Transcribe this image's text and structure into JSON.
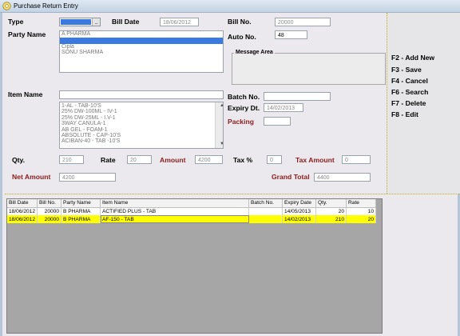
{
  "window": {
    "title": "Purchase Return Entry",
    "accent": "#3a7ae0"
  },
  "form": {
    "type": {
      "label": "Type",
      "value": ""
    },
    "bill_date": {
      "label": "Bill Date",
      "value": "18/06/2012"
    },
    "bill_no": {
      "label": "Bill No.",
      "value": "20000"
    },
    "party_name": {
      "label": "Party Name",
      "input_value": "A PHARMA",
      "list": [
        "",
        "Cipla",
        "SONU SHARMA"
      ]
    },
    "auto_no": {
      "label": "Auto No.",
      "value": "48"
    },
    "message_area": {
      "label": "Message Area"
    },
    "item_name": {
      "label": "Item Name",
      "input_value": "",
      "list": [
        "1-AL - TAB-10'S",
        "25% DW-100ML - IV-1",
        "25% DW-25ML - I.V-1",
        "3WAY CANULA-1",
        "AB GEL - FOAM-1",
        "ABSOLUTE - CAP-10'S",
        "ACIBAN-40 - TAB -10'S"
      ]
    },
    "batch_no": {
      "label": "Batch No.",
      "value": ""
    },
    "expiry_dt": {
      "label": "Expiry Dt.",
      "value": "14/02/2013"
    },
    "packing": {
      "label": "Packing",
      "value": ""
    },
    "qty": {
      "label": "Qty.",
      "value": "210"
    },
    "rate": {
      "label": "Rate",
      "value": "20"
    },
    "amount": {
      "label": "Amount",
      "value": "4200"
    },
    "tax_pct": {
      "label": "Tax %",
      "value": "0"
    },
    "tax_amount": {
      "label": "Tax Amount",
      "value": "0"
    },
    "net_amount": {
      "label": "Net Amount",
      "value": "4200"
    },
    "grand_total": {
      "label": "Grand Total",
      "value": "4400"
    }
  },
  "shortcuts": [
    "F2 - Add New",
    "F3 - Save",
    "F4 - Cancel",
    "F6 - Search",
    "F7 - Delete",
    "F8 - Edit"
  ],
  "grid": {
    "columns": [
      "Bill Date",
      "Bill No.",
      "Party Name",
      "Item Name",
      "Batch No.",
      "Expiry Date",
      "Qty.",
      "Rate"
    ],
    "rows": [
      [
        "18/06/2012",
        "20000",
        "B PHARMA",
        "ACTIFIED PLUS - TAB",
        "",
        "14/05/2013",
        "20",
        "10"
      ],
      [
        "18/06/2012",
        "20000",
        "B PHARMA",
        "AF-150 - TAB",
        "",
        "14/02/2013",
        "210",
        "20"
      ]
    ],
    "selected_row": 1,
    "highlight": "#ffff00"
  }
}
